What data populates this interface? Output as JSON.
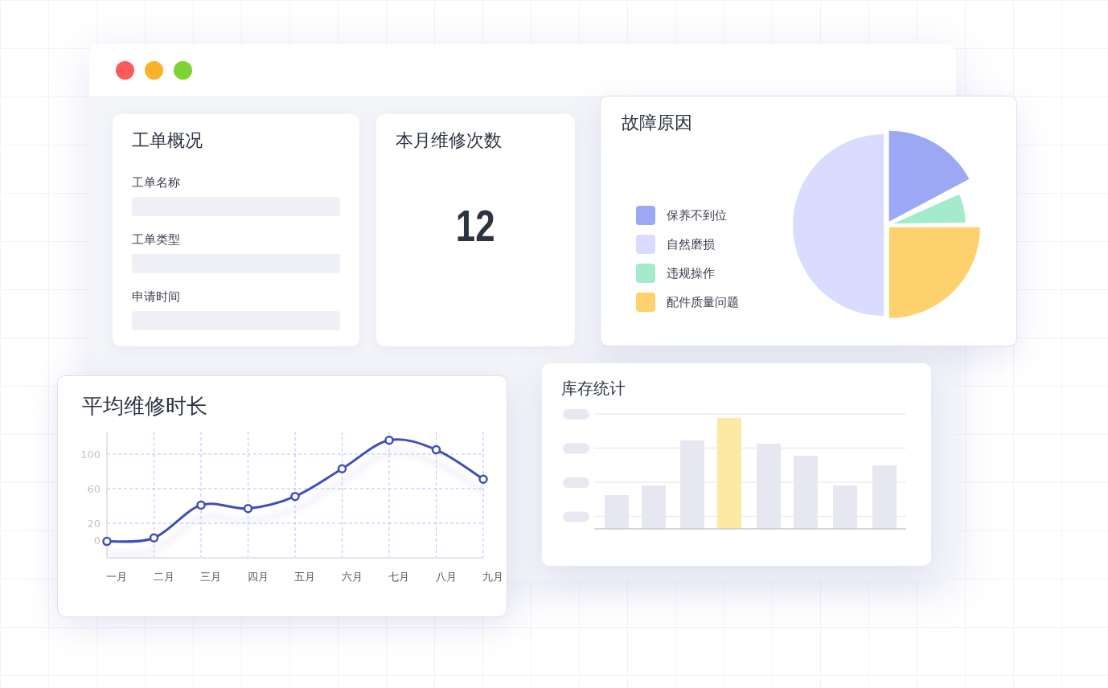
{
  "work_order": {
    "title": "工单概况",
    "fields": [
      {
        "label": "工单名称"
      },
      {
        "label": "工单类型"
      },
      {
        "label": "申请时间"
      }
    ]
  },
  "monthly_repairs": {
    "title": "本月维修次数",
    "value": "12"
  },
  "fault_causes": {
    "title": "故障原因",
    "legend": [
      {
        "label": "保养不到位",
        "color": "#9da8f5"
      },
      {
        "label": "自然磨损",
        "color": "#d9dcfe"
      },
      {
        "label": "违规操作",
        "color": "#a3ebcb"
      },
      {
        "label": "配件质量问题",
        "color": "#fdd26e"
      }
    ]
  },
  "avg_repair_time": {
    "title": "平均维修时长",
    "chart_data": {
      "type": "line",
      "categories": [
        "一月",
        "二月",
        "三月",
        "四月",
        "五月",
        "六月",
        "七月",
        "八月",
        "九月"
      ],
      "series": [
        {
          "color": "#3f4fb8",
          "marker": "o",
          "values": [
            -1,
            3,
            41,
            37,
            51,
            83,
            116,
            105,
            71
          ]
        }
      ],
      "grid": true,
      "ylim": [
        -20,
        126
      ],
      "yticks": [
        0,
        20,
        60,
        100
      ]
    }
  },
  "inventory": {
    "title": "库存统计"
  }
}
